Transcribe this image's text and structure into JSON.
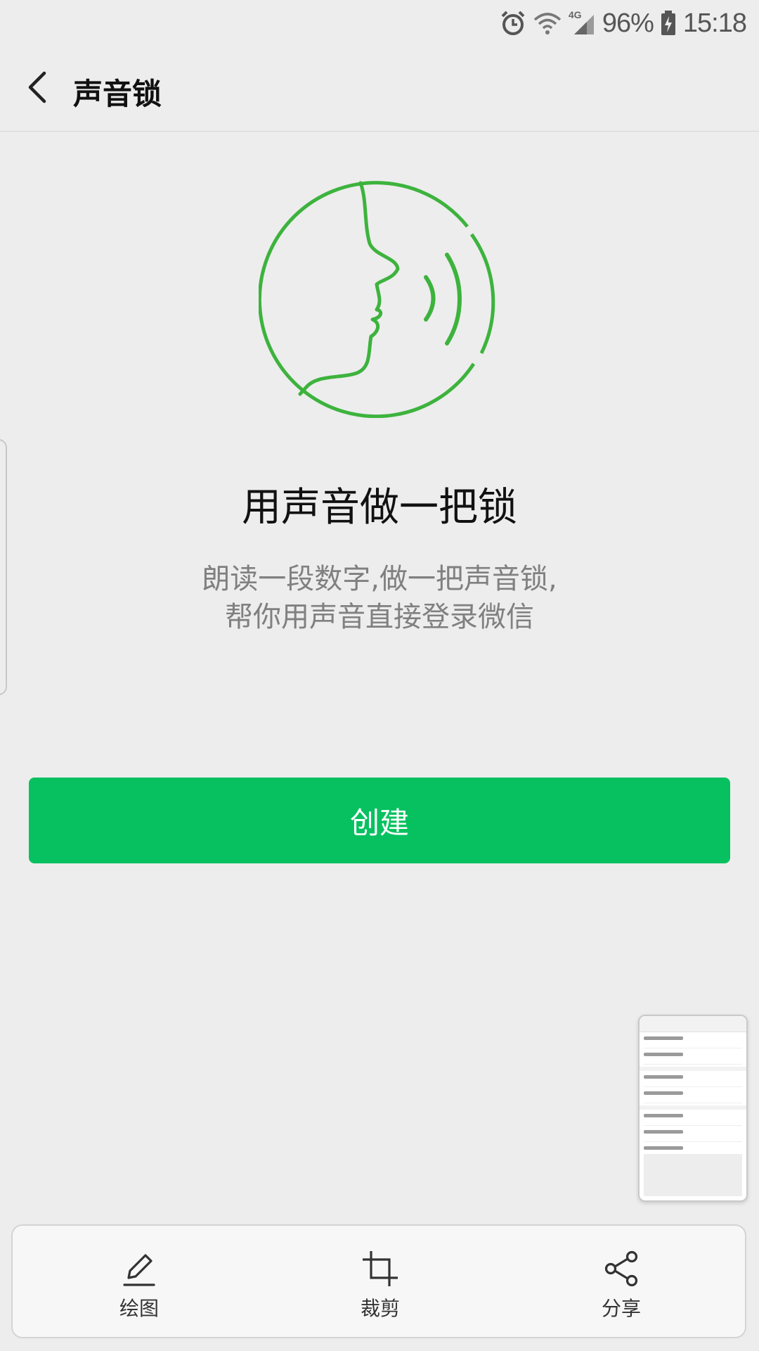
{
  "status_bar": {
    "network": "4G",
    "battery": "96%",
    "time": "15:18"
  },
  "header": {
    "title": "声音锁"
  },
  "hero": {
    "headline": "用声音做一把锁",
    "desc_line1": "朗读一段数字,做一把声音锁,",
    "desc_line2": "帮你用声音直接登录微信"
  },
  "actions": {
    "create_label": "创建"
  },
  "toolbar": {
    "draw_label": "绘图",
    "crop_label": "裁剪",
    "share_label": "分享"
  },
  "colors": {
    "accent_green": "#07c160",
    "icon_green": "#3db33d",
    "background": "#ededed"
  }
}
